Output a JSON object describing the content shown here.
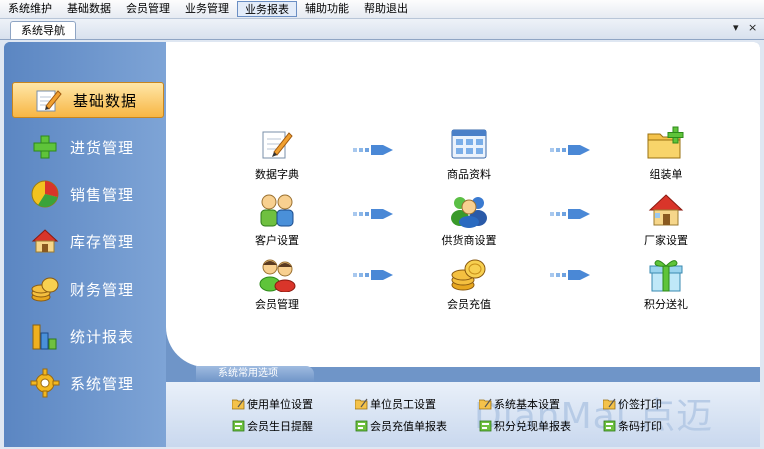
{
  "menu": [
    "系统维护",
    "基础数据",
    "会员管理",
    "业务管理",
    "业务报表",
    "辅助功能",
    "帮助退出"
  ],
  "menu_active_index": 4,
  "tab": {
    "label": "系统导航",
    "dropdown_glyph": "▾",
    "close_glyph": "×"
  },
  "sidebar": [
    {
      "label": "基础数据",
      "icon": "pencil-note-icon",
      "active": true
    },
    {
      "label": "进货管理",
      "icon": "green-plus-icon",
      "active": false
    },
    {
      "label": "销售管理",
      "icon": "pie-chart-icon",
      "active": false
    },
    {
      "label": "库存管理",
      "icon": "house-icon",
      "active": false
    },
    {
      "label": "财务管理",
      "icon": "coins-icon",
      "active": false
    },
    {
      "label": "统计报表",
      "icon": "bar-chart-icon",
      "active": false
    },
    {
      "label": "系统管理",
      "icon": "gear-icon",
      "active": false
    }
  ],
  "modules": [
    {
      "label": "数据字典",
      "icon": "pencil-note-icon"
    },
    {
      "label": "商品资料",
      "icon": "window-grid-icon"
    },
    {
      "label": "组装单",
      "icon": "folder-add-icon"
    },
    {
      "label": "客户设置",
      "icon": "users-icon"
    },
    {
      "label": "供货商设置",
      "icon": "people-group-icon"
    },
    {
      "label": "厂家设置",
      "icon": "house-icon"
    },
    {
      "label": "会员管理",
      "icon": "members-icon"
    },
    {
      "label": "会员充值",
      "icon": "coins-icon"
    },
    {
      "label": "积分送礼",
      "icon": "gift-icon"
    }
  ],
  "options_title": "系统常用选项",
  "options": [
    {
      "label": "使用单位设置",
      "icon": "folder-pen-icon"
    },
    {
      "label": "单位员工设置",
      "icon": "folder-pen-icon"
    },
    {
      "label": "系统基本设置",
      "icon": "folder-pen-icon"
    },
    {
      "label": "价签打印",
      "icon": "folder-pen-icon"
    },
    {
      "label": "会员生日提醒",
      "icon": "green-report-icon"
    },
    {
      "label": "会员充值单报表",
      "icon": "green-report-icon"
    },
    {
      "label": "积分兑现单报表",
      "icon": "green-report-icon"
    },
    {
      "label": "条码打印",
      "icon": "green-report-icon"
    }
  ],
  "watermark": "DianMai 点迈",
  "colors": {
    "accent": "#6f95c8",
    "active_nav": "#f7b644",
    "active_nav_border": "#c8861e"
  }
}
